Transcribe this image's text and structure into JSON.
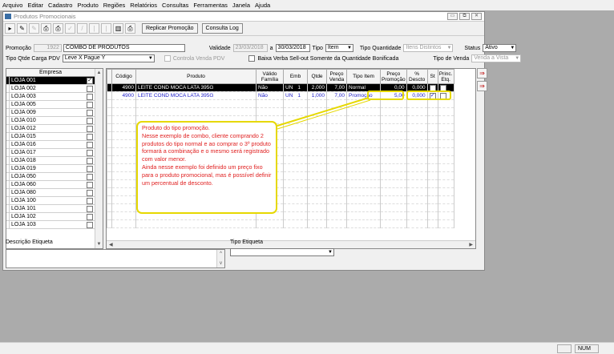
{
  "menu": [
    "Arquivo",
    "Editar",
    "Cadastro",
    "Produto",
    "Regiões",
    "Relatórios",
    "Consultas",
    "Ferramentas",
    "Janela",
    "Ajuda"
  ],
  "window": {
    "title": "Produtos Promocionais"
  },
  "toolbar": {
    "replicate_label": "Replicar Promoção",
    "log_label": "Consulta Log"
  },
  "form": {
    "promo_label": "Promoção",
    "promo_id": "1922",
    "promo_name": "COMBO DE PRODUTOS",
    "validity_label": "Validade",
    "date_from": "23/03/2018",
    "date_sep": "a",
    "date_to": "30/03/2018",
    "type_label": "Tipo",
    "type_value": "Item",
    "qty_type_label": "Tipo Quantidade",
    "qty_type_value": "Itens Distintos",
    "status_label": "Status",
    "status_value": "Ativo",
    "pdv_type_label": "Tipo Qtde Carga PDV",
    "pdv_type_value": "Leve X Pague Y",
    "controls_pdv_label": "Controla Venda PDV",
    "verba_label": "Baixa Verba Sell-out Somente da Quantidade Bonificada",
    "sale_type_label": "Tipo de Venda",
    "sale_type_value": "Venda a Vista"
  },
  "stores": {
    "header": "Empresa",
    "rows": [
      "LOJA 001",
      "LOJA 002",
      "LOJA 003",
      "LOJA 005",
      "LOJA 009",
      "LOJA 010",
      "LOJA 012",
      "LOJA 015",
      "LOJA 016",
      "LOJA 017",
      "LOJA 018",
      "LOJA 019",
      "LOJA 050",
      "LOJA 060",
      "LOJA 080",
      "LOJA 100",
      "LOJA 101",
      "LOJA 102",
      "LOJA 103"
    ],
    "checked": [
      "LOJA 001"
    ]
  },
  "grid": {
    "headers": [
      "Código",
      "Produto",
      "Válido Família",
      "Emb",
      "Qtde",
      "Preço Venda",
      "Tipo Item",
      "Preço Promoção",
      "% Descto",
      "St",
      "Princ. Etq."
    ],
    "rows": [
      [
        "4900",
        "LEITE COND MOCA LATA 395G",
        "Não",
        "UN",
        "1",
        "2,000",
        "7,00",
        "Normal",
        "0,00",
        "0,000"
      ],
      [
        "4900",
        "LEITE COND MOCA LATA 395G",
        "Não",
        "UN",
        "1",
        "1,000",
        "7,00",
        "Promoção",
        "5,00",
        "0,000"
      ]
    ]
  },
  "annotation": [
    "Produto do tipo promoção.",
    "Nesse exemplo de combo, cliente comprando 2 produtos do tipo normal e ao comprar o 3º produto formará a combinação e o mesmo será registrado com valor menor.",
    "Ainda nesse exemplo foi definido um preço fixo para o produto promocional, mas é possível definir um percentual de desconto."
  ],
  "bottom": {
    "desc_label": "Descrição Etiqueta",
    "tag_type_label": "Tipo Etiqueta"
  },
  "status": {
    "num": "NUM"
  },
  "colors": {
    "annotation_border": "#e6d800",
    "annotation_text": "#e02020",
    "promo_row_text": "#1c1cc8"
  }
}
